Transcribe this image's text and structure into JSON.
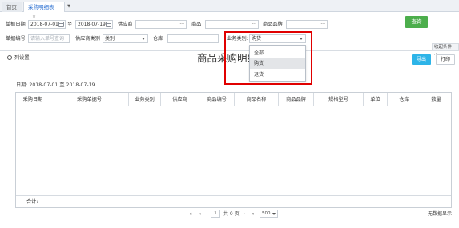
{
  "tabs": [
    {
      "label": "首页"
    },
    {
      "label": "采购明细表",
      "close": "×"
    }
  ],
  "tab_more": "▼",
  "filters": {
    "doc_date_label": "单据日期",
    "date_from": "2018-07-01",
    "date_sep": "至",
    "date_to": "2018-07-19",
    "supplier_label": "供应商",
    "supplier_value": "",
    "product_label": "商品",
    "product_value": "",
    "brand_label": "商品品牌",
    "brand_value": "",
    "doc_no_label": "单据编号",
    "doc_no_placeholder": "请输入单号查询",
    "supplier_type_label": "供应商类别",
    "supplier_type_value": "类别",
    "warehouse_label": "仓库",
    "warehouse_value": "",
    "biz_type_label": "业务类别:",
    "biz_type_value": "购货",
    "ellipsis": "···"
  },
  "biz_type_options": [
    {
      "label": "全部",
      "selected": false
    },
    {
      "label": "购货",
      "selected": true
    },
    {
      "label": "退货",
      "selected": false
    }
  ],
  "buttons": {
    "query": "查询",
    "collapse": "收起条件 ︿",
    "export": "导出",
    "print": "打印",
    "settings": "列设置"
  },
  "report": {
    "title": "商品采购明细表",
    "date_range": "日期: 2018-07-01 至 2018-07-19"
  },
  "table": {
    "columns": [
      "采购日期",
      "采购单据号",
      "业务类别",
      "供应商",
      "商品编号",
      "商品名称",
      "商品品牌",
      "规格型号",
      "单位",
      "仓库",
      "数量"
    ],
    "rows": [],
    "total_label": "合计:"
  },
  "pager": {
    "first": "⇤",
    "prev": "⇠",
    "page": "1",
    "of_pages": "共 0 页",
    "next": "⇢",
    "last": "⇥",
    "page_size": "500"
  },
  "no_data": "无数据显示",
  "colors": {
    "accent": "#2a6fd1",
    "query_button": "#4cae4c",
    "export_button": "#2db4e8",
    "highlight_box": "#e00000"
  }
}
